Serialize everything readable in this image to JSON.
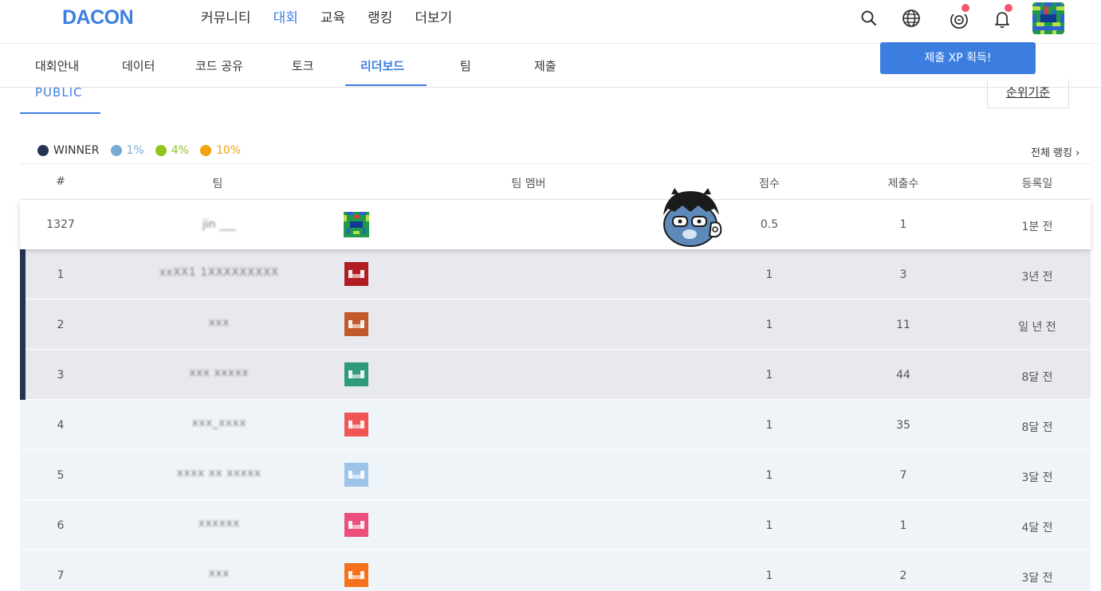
{
  "header": {
    "logo": "DACON",
    "nav": [
      "커뮤니티",
      "대회",
      "교육",
      "랭킹",
      "더보기"
    ],
    "active_nav": "대회",
    "icons": [
      "search-icon",
      "globe-icon",
      "xp-icon",
      "bell-icon"
    ]
  },
  "tooltip": {
    "text": "제출 XP 획득!"
  },
  "subnav": {
    "items": [
      "대회안내",
      "데이터",
      "코드 공유",
      "토크",
      "리더보드",
      "팀",
      "제출"
    ],
    "active": "리더보드"
  },
  "board": {
    "tab": "PUBLIC",
    "rank_button": "순위기준",
    "all_ranking": "전체 랭킹 ›"
  },
  "legend": [
    {
      "label": "WINNER",
      "color": "#243452"
    },
    {
      "label": "1%",
      "color": "#7ba9d6"
    },
    {
      "label": "4%",
      "color": "#8fc31f"
    },
    {
      "label": "10%",
      "color": "#f0a30a"
    }
  ],
  "table": {
    "headers": {
      "rank": "#",
      "team": "팀",
      "members": "팀 멤버",
      "score": "점수",
      "submissions": "제출수",
      "date": "등록일"
    },
    "my_row": {
      "rank": "1327",
      "team": "jin ___",
      "score": "0.5",
      "submissions": "1",
      "date": "1분 전"
    },
    "rows": [
      {
        "rank": "1",
        "team": "xxXX1 1XXXXXXXXX",
        "score": "1",
        "submissions": "3",
        "date": "3년 전",
        "winner": true,
        "avatar_color": "#b01e24"
      },
      {
        "rank": "2",
        "team": "xxx",
        "score": "1",
        "submissions": "11",
        "date": "일 년 전",
        "winner": true,
        "avatar_color": "#c2592a"
      },
      {
        "rank": "3",
        "team": "xxx xxxxx",
        "score": "1",
        "submissions": "44",
        "date": "8달 전",
        "winner": true,
        "avatar_color": "#2e9a7c"
      },
      {
        "rank": "4",
        "team": "xxx_xxxx",
        "score": "1",
        "submissions": "35",
        "date": "8달 전",
        "winner": false,
        "avatar_color": "#ef5554"
      },
      {
        "rank": "5",
        "team": "xxxx xx xxxxx",
        "score": "1",
        "submissions": "7",
        "date": "3달 전",
        "winner": false,
        "avatar_color": "#9fc4ea"
      },
      {
        "rank": "6",
        "team": "xxxxxx",
        "score": "1",
        "submissions": "1",
        "date": "4달 전",
        "winner": false,
        "avatar_color": "#ec4f7c"
      },
      {
        "rank": "7",
        "team": "xxx",
        "score": "1",
        "submissions": "2",
        "date": "3달 전",
        "winner": false,
        "avatar_color": "#f5711b"
      }
    ]
  }
}
